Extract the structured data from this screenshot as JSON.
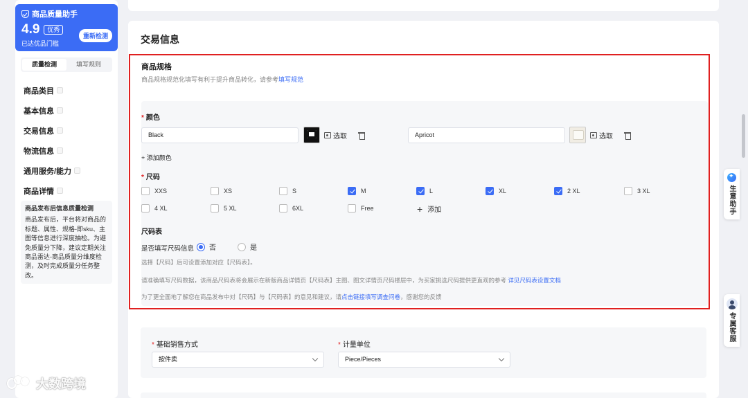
{
  "assistant": {
    "title": "商品质量助手",
    "score": "4.9",
    "rating": "优秀",
    "subtitle": "已达优品门槛",
    "recheck_label": "重新检测"
  },
  "tabs": [
    {
      "label": "质量检测",
      "active": true
    },
    {
      "label": "填写规则",
      "active": false
    }
  ],
  "nav": [
    {
      "label": "商品类目"
    },
    {
      "label": "基本信息"
    },
    {
      "label": "交易信息"
    },
    {
      "label": "物流信息"
    },
    {
      "label": "通用服务/能力"
    },
    {
      "label": "商品详情"
    }
  ],
  "info": {
    "title": "商品发布后信息质量检测",
    "body": "商品发布后，平台将对商品的标题、属性、规格-即sku、主图等信息进行深度抽检。为避免质量分下降，建议定期关注商品雷达-商品质量分维度检测，及时完成质量分任务整改。"
  },
  "section": {
    "title": "交易信息"
  },
  "spec": {
    "title": "商品规格",
    "desc": "商品规格规范化填写有利于提升商品转化，请参考",
    "desc_link": "填写规范",
    "color_label": "颜色",
    "colors": [
      {
        "value": "Black",
        "pick_label": "选取",
        "swatch": "black"
      },
      {
        "value": "Apricot",
        "pick_label": "选取",
        "swatch": "apricot"
      }
    ],
    "add_color": "+ 添加颜色",
    "size_label": "尺码",
    "sizes": [
      {
        "label": "XXS",
        "checked": false
      },
      {
        "label": "XS",
        "checked": false
      },
      {
        "label": "S",
        "checked": false
      },
      {
        "label": "M",
        "checked": true
      },
      {
        "label": "L",
        "checked": true
      },
      {
        "label": "XL",
        "checked": true
      },
      {
        "label": "2 XL",
        "checked": true
      },
      {
        "label": "3 XL",
        "checked": false
      },
      {
        "label": "4 XL",
        "checked": false
      },
      {
        "label": "5 XL",
        "checked": false
      },
      {
        "label": "6XL",
        "checked": false
      },
      {
        "label": "Free",
        "checked": false
      }
    ],
    "add_size": "添加",
    "size_table_label": "尺码表",
    "size_table_question": "是否填写尺码信息",
    "options": [
      {
        "label": "否",
        "selected": true
      },
      {
        "label": "是",
        "selected": false
      }
    ],
    "hint": "选择【尺码】后可设置添加对应【尺码表】。",
    "note1": "请准确填写尺码数据，该商品尺码表将会展示在新版商品详情页【尺码表】主图、图文详情页尺码楼层中，为买家挑选尺码提供更直观的参考",
    "note1_link": "详见尺码表设置文档",
    "note2": "为了更全面地了解您在商品发布中对【尺码】与【尺码表】的意见和建议，请",
    "note2_link": "点击链接填写调查问卷",
    "note2_tail": "，感谢您的反馈"
  },
  "sales": {
    "method_label": "基础销售方式",
    "method_value": "按件卖",
    "unit_label": "计量单位",
    "unit_value": "Piece/Pieces"
  },
  "side_buttons": {
    "ai": "生意助手",
    "cs": "专属客服"
  },
  "watermark": "大数跨境",
  "colors": {
    "accent": "#3b6cf5",
    "highlight_border": "#e02020",
    "required": "#e02020"
  }
}
